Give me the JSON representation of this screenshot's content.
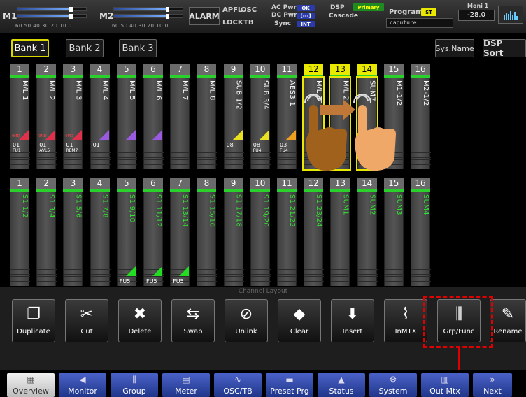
{
  "meters": [
    {
      "label": "M1",
      "scale": "60 50 40 30 20 10  0",
      "levels": [
        0.78,
        0.78
      ]
    },
    {
      "label": "M2",
      "scale": "60 50 40 30 20 10  0",
      "levels": [
        0.78,
        0.78
      ]
    }
  ],
  "status": {
    "alarm": "ALARM",
    "apfl": "APFL",
    "osc": "OSC",
    "lock": "LOCK",
    "tb": "TB",
    "ac_pwr": "AC Pwr",
    "ac_pwr_val": "OK",
    "dc_pwr": "DC Pwr",
    "dc_pwr_val": "[---]",
    "sync": "Sync",
    "sync_val": "INT",
    "dsp": "DSP",
    "dsp_val": "Primary",
    "cascade": "Cascade",
    "program": "Program",
    "program_val": "ST",
    "program_name": "caputure",
    "moni": "Moni 1",
    "moni_val": "-28.0"
  },
  "banks": [
    "Bank 1",
    "Bank 2",
    "Bank 3"
  ],
  "sys_name": "Sys.Name",
  "dsp_sort": "DSP Sort",
  "row1": [
    {
      "num": "1",
      "name": "M/L 1",
      "tri": "#e0304a",
      "tag": "0MD",
      "foot": "01",
      "sub": "FU1"
    },
    {
      "num": "2",
      "name": "M/L 2",
      "tri": "#e0304a",
      "tag": "0MD",
      "foot": "01",
      "sub": "AVL5"
    },
    {
      "num": "3",
      "name": "M/L 3",
      "tri": "#e0304a",
      "tag": "0MD",
      "foot": "01",
      "sub": "REM7"
    },
    {
      "num": "4",
      "name": "M/L 4",
      "tri": "#9a5ae0",
      "tag": "",
      "foot": "01",
      "sub": ""
    },
    {
      "num": "5",
      "name": "M/L 5",
      "tri": "#9a5ae0",
      "tag": "",
      "foot": "",
      "sub": ""
    },
    {
      "num": "6",
      "name": "M/L 6",
      "tri": "#9a5ae0",
      "tag": "",
      "foot": "",
      "sub": ""
    },
    {
      "num": "7",
      "name": "M/L 7",
      "tri": "",
      "tag": "",
      "foot": "",
      "sub": ""
    },
    {
      "num": "8",
      "name": "M/L 8",
      "tri": "",
      "tag": "",
      "foot": "",
      "sub": ""
    },
    {
      "num": "9",
      "name": "SUB 1/2",
      "tri": "#e8e020",
      "tag": "",
      "foot": "08",
      "sub": ""
    },
    {
      "num": "10",
      "name": "SUB 3/4",
      "tri": "#e8e020",
      "tag": "",
      "foot": "08",
      "sub": "FU4"
    },
    {
      "num": "11",
      "name": "AES3 1",
      "tri": "#f0a020",
      "tag": "",
      "foot": "03",
      "sub": "FU4"
    },
    {
      "num": "12",
      "name": "M/L 1",
      "tri": "",
      "tag": "",
      "foot": "",
      "sub": "",
      "sel": true
    },
    {
      "num": "13",
      "name": "M/L 2",
      "tri": "",
      "tag": "",
      "foot": "",
      "sub": "",
      "sel": true
    },
    {
      "num": "14",
      "name": "SUM7",
      "tri": "",
      "tag": "",
      "foot": "",
      "sub": "",
      "sel": true
    },
    {
      "num": "15",
      "name": "M1-1/2",
      "tri": "",
      "tag": "",
      "foot": "",
      "sub": ""
    },
    {
      "num": "16",
      "name": "M2-1/2",
      "tri": "",
      "tag": "",
      "foot": "",
      "sub": ""
    }
  ],
  "row2": [
    {
      "num": "1",
      "name": "S1 1/2",
      "tri": "",
      "foot": ""
    },
    {
      "num": "2",
      "name": "S1 3/4",
      "tri": "",
      "foot": ""
    },
    {
      "num": "3",
      "name": "S1 5/6",
      "tri": "",
      "foot": ""
    },
    {
      "num": "4",
      "name": "S1 7/8",
      "tri": "",
      "foot": ""
    },
    {
      "num": "5",
      "name": "S1 9/10",
      "tri": "#22dd22",
      "foot": "FU5"
    },
    {
      "num": "6",
      "name": "S1 11/12",
      "tri": "#22dd22",
      "foot": "FU5"
    },
    {
      "num": "7",
      "name": "S1 13/14",
      "tri": "#22dd22",
      "foot": "FU5"
    },
    {
      "num": "8",
      "name": "S1 15/16",
      "tri": "",
      "foot": ""
    },
    {
      "num": "9",
      "name": "S1 17/18",
      "tri": "",
      "foot": ""
    },
    {
      "num": "10",
      "name": "S1 19/20",
      "tri": "",
      "foot": ""
    },
    {
      "num": "11",
      "name": "S1 21/22",
      "tri": "",
      "foot": ""
    },
    {
      "num": "12",
      "name": "S1 23/24",
      "tri": "",
      "foot": ""
    },
    {
      "num": "13",
      "name": "SUM1",
      "tri": "",
      "foot": ""
    },
    {
      "num": "14",
      "name": "SUM2",
      "tri": "",
      "foot": ""
    },
    {
      "num": "15",
      "name": "SUM3",
      "tri": "",
      "foot": ""
    },
    {
      "num": "16",
      "name": "SUM4",
      "tri": "",
      "foot": ""
    }
  ],
  "layout_title": "Channel Layout",
  "edit_buttons": [
    {
      "label": "Duplicate",
      "icon": "duplicate-icon"
    },
    {
      "label": "Cut",
      "icon": "scissors-icon"
    },
    {
      "label": "Delete",
      "icon": "x-icon"
    },
    {
      "label": "Swap",
      "icon": "swap-icon"
    },
    {
      "label": "Unlink",
      "icon": "unlink-icon"
    },
    {
      "label": "Clear",
      "icon": "eraser-icon"
    },
    {
      "label": "Insert",
      "icon": "insert-icon"
    },
    {
      "label": "InMTX",
      "icon": "cable-icon"
    },
    {
      "label": "Grp/Func",
      "icon": "faders-icon"
    },
    {
      "label": "Rename",
      "icon": "pencil-icon"
    }
  ],
  "nav": [
    {
      "label": "Overview",
      "icon": "grid-icon"
    },
    {
      "label": "Monitor",
      "icon": "speaker-icon"
    },
    {
      "label": "Group",
      "icon": "faders-icon"
    },
    {
      "label": "Meter",
      "icon": "meter-icon"
    },
    {
      "label": "OSC/TB",
      "icon": "wave-icon"
    },
    {
      "label": "Preset Prg",
      "icon": "box-icon"
    },
    {
      "label": "Status",
      "icon": "warning-icon"
    },
    {
      "label": "System",
      "icon": "gears-icon"
    },
    {
      "label": "Out Mtx",
      "icon": "matrix-icon"
    },
    {
      "label": "Next",
      "icon": "chevrons-right-icon"
    }
  ],
  "colors": {
    "highlight": "#e8e800",
    "accent_red": "#e00000",
    "nav_blue": "#2a40a0"
  }
}
